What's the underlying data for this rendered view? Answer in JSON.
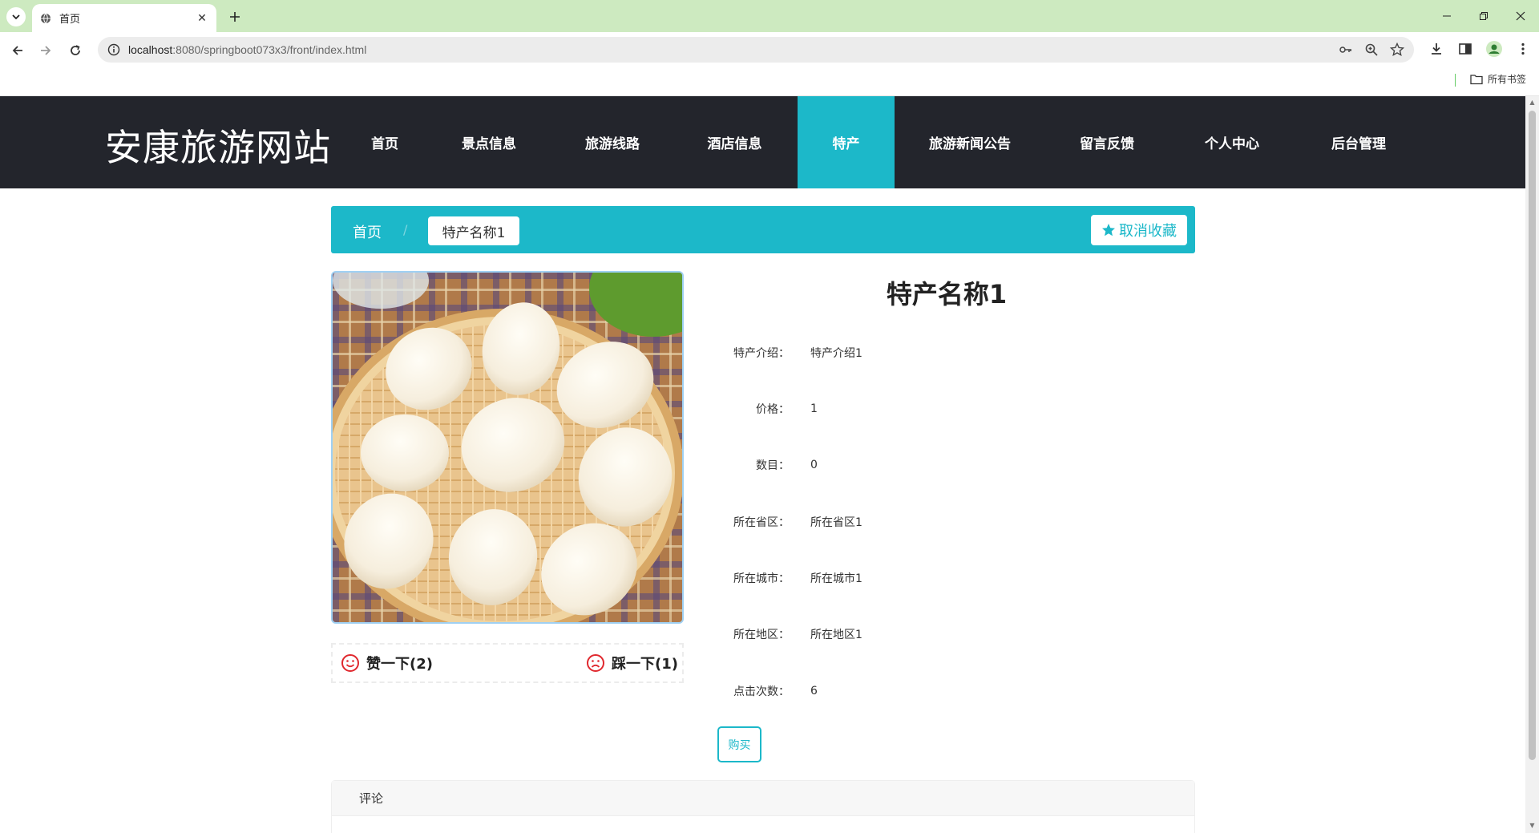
{
  "browser": {
    "tab_title": "首页",
    "url_host": "localhost",
    "url_path": ":8080/springboot073x3/front/index.html",
    "bookmarks_label": "所有书签"
  },
  "site": {
    "logo": "安康旅游网站",
    "nav": [
      {
        "label": "首页",
        "active": false
      },
      {
        "label": "景点信息",
        "active": false
      },
      {
        "label": "旅游线路",
        "active": false
      },
      {
        "label": "酒店信息",
        "active": false
      },
      {
        "label": "特产",
        "active": true
      },
      {
        "label": "旅游新闻公告",
        "active": false
      },
      {
        "label": "留言反馈",
        "active": false
      },
      {
        "label": "个人中心",
        "active": false
      },
      {
        "label": "后台管理",
        "active": false
      }
    ]
  },
  "breadcrumb": {
    "home": "首页",
    "separator": "/",
    "current": "特产名称1",
    "favorite_label": "取消收藏"
  },
  "product": {
    "title": "特产名称1",
    "fields": [
      {
        "label": "特产介绍：",
        "value": "特产介绍1"
      },
      {
        "label": "价格：",
        "value": "1"
      },
      {
        "label": "数目：",
        "value": "0"
      },
      {
        "label": "所在省区：",
        "value": "所在省区1"
      },
      {
        "label": "所在城市：",
        "value": "所在城市1"
      },
      {
        "label": "所在地区：",
        "value": "所在地区1"
      },
      {
        "label": "点击次数：",
        "value": "6"
      }
    ],
    "like_label": "赞一下(2)",
    "dislike_label": "踩一下(1)",
    "buy_label": "购买"
  },
  "comments": {
    "title": "评论"
  },
  "colors": {
    "accent": "#1cb8c9",
    "header_bg": "#23252c",
    "tabbar_bg": "#cdeac0",
    "vote_icon": "#e0282e"
  }
}
